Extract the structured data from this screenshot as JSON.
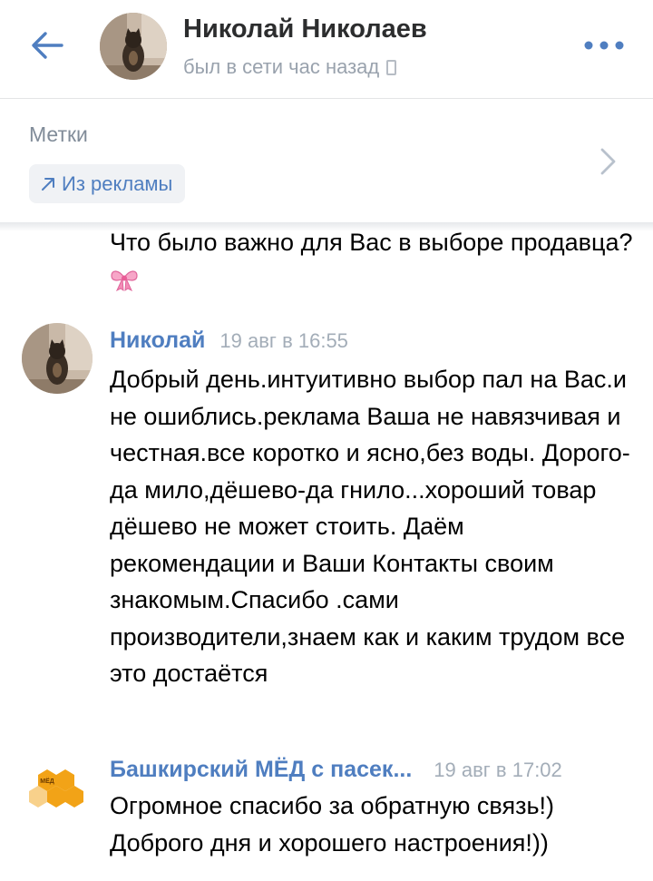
{
  "header": {
    "name": "Николай Николаев",
    "status": "был в сети час назад",
    "icons": {
      "back": "back-arrow-icon",
      "more": "more-dots-icon",
      "device": "phone-icon"
    }
  },
  "labels": {
    "title": "Метки",
    "tag": "Из рекламы",
    "tag_icon": "arrow-up-right-icon"
  },
  "messages": [
    {
      "text": "Что было важно для Вас в выборе продавца?",
      "emoji": "ribbon-bow-icon"
    },
    {
      "author": "Николай",
      "time": "19 авг в 16:55",
      "text": "Добрый день.интуитивно выбор пал на Вас.и не ошиблись.реклама Ваша не навязчивая и честная.все коротко и ясно,без воды. Дорого-да мило,дёшево-да гнило...хороший товар дёшево не может стоить. Даём рекомендации и Ваши Контакты своим знакомым.Спасибо .сами производители,знаем как и каким трудом все это достаётся"
    },
    {
      "author": "Башкирский МЁД с пасек...",
      "time": "19 авг в 17:02",
      "text": "Огромное спасибо за обратную связь!) Доброго дня и хорошего настроения!))",
      "avatar_text": "МЁД"
    }
  ],
  "colors": {
    "accent": "#4f7ec0",
    "secondary_text": "#99a2ad",
    "tag_bg": "#f0f2f5",
    "honey": "#f2a317"
  }
}
